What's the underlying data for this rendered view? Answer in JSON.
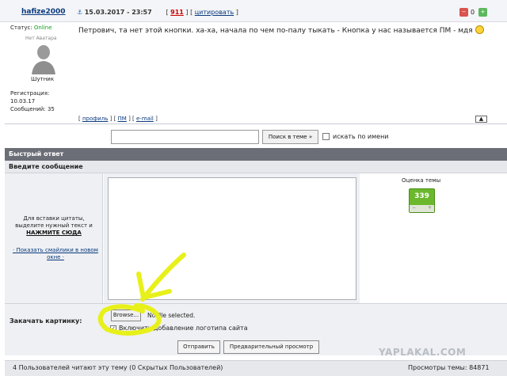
{
  "post": {
    "author": "hafize2000",
    "datetime": "15.03.2017 - 23:57",
    "post_number": "911",
    "quote_label": "цитировать",
    "rating_value": "0",
    "status_label": "Статус:",
    "status_value": "Online",
    "no_avatar": "Нет Аватара",
    "user_title": "Шутник",
    "registration_label": "Регистрация:",
    "registration_date": "10.03.17",
    "messages_label": "Сообщений:",
    "messages_count": "35",
    "body": "Петрович, та нет этой кнопки. ха-ха, начала по чем по-палу тыкать - Кнопка у нас называется ПМ - мдя",
    "links": {
      "profile": "профиль",
      "pm": "ПМ",
      "email": "e-mail"
    }
  },
  "search": {
    "button_label": "Поиск в теме »",
    "name_check_label": "искать по имени"
  },
  "quick_reply": {
    "header": "Быстрый ответ",
    "enter_message": "Введите сообщение",
    "quote_hint_line1": "Для вставки цитаты,",
    "quote_hint_line2": "выделите нужный текст и",
    "quote_hint_bold": "НАЖМИТЕ СЮДА",
    "smiles_link": "Показать смайлики в новом окне",
    "theme_rating_label": "Оценка темы",
    "theme_rating_value": "339",
    "upload_label": "Закачать картинку:",
    "browse_label": "Browse...",
    "file_status": "No file selected.",
    "logo_label": "Включить добавление логотипа сайта",
    "send_label": "Отправить",
    "preview_label": "Предварительный просмотр"
  },
  "watermark": "YAPLAKAL.COM",
  "footer": {
    "readers": "4 Пользователей читают эту тему (0 Скрытых Пользователей)",
    "views": "Просмотры темы: 84871"
  },
  "colors": {
    "link": "#0b3a7e",
    "online": "#11a11f",
    "header_bar": "#6b6e76",
    "rating_green": "#6bb82c",
    "annotation": "#e8f01a"
  }
}
